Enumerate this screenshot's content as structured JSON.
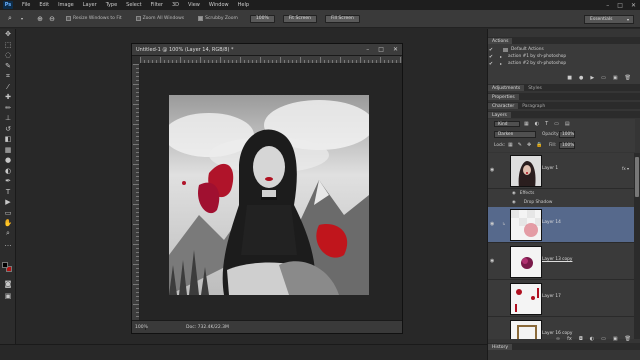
{
  "app": {
    "logo_text": "Ps"
  },
  "menu": [
    "File",
    "Edit",
    "Image",
    "Layer",
    "Type",
    "Select",
    "Filter",
    "3D",
    "View",
    "Window",
    "Help"
  ],
  "options_bar": {
    "resize_windows": "Resize Windows to Fit",
    "zoom_all": "Zoom All Windows",
    "scrubby_zoom": "Scrubby Zoom",
    "btn_100": "100%",
    "btn_fit": "Fit Screen",
    "btn_fill": "Fill Screen",
    "workspace": "Essentials"
  },
  "document": {
    "title": "Untitled-1 @ 100% (Layer 14, RGB/8) *",
    "zoom": "100%",
    "doc_info": "Doc: 732.4K/22.3M"
  },
  "actions_panel": {
    "tab": "Actions",
    "items": [
      {
        "label": "Default Actions",
        "indent": 0
      },
      {
        "label": "action #1 by sh-photoshop",
        "indent": 1
      },
      {
        "label": "action #2 by sh-photoshop",
        "indent": 1
      }
    ]
  },
  "panel_tabs_1": [
    "Adjustments",
    "Styles"
  ],
  "panel_tabs_2": [
    "Properties"
  ],
  "panel_tabs_3": [
    "Character",
    "Paragraph"
  ],
  "layers_panel": {
    "tab": "Layers",
    "filter_kind": "Kind",
    "blend_mode": "Darken",
    "opacity_label": "Opacity:",
    "opacity_value": "100%",
    "lock_label": "Lock:",
    "fill_label": "Fill:",
    "fill_value": "100%",
    "layers": [
      {
        "name": "Layer 1",
        "selected": false,
        "fx": true
      },
      {
        "name": "Layer 14",
        "selected": true,
        "fx": false
      },
      {
        "name": "Layer 13 copy",
        "selected": false,
        "fx": false
      },
      {
        "name": "Layer 17",
        "selected": false,
        "fx": false
      },
      {
        "name": "Layer 16 copy",
        "selected": false,
        "fx": false
      }
    ],
    "effects_label": "Effects",
    "drop_shadow_label": "Drop Shadow"
  },
  "history_tab": "History",
  "colors": {
    "selected_layer": "#56698c",
    "foreground": "#000000",
    "background_swatch": "#b01010",
    "brand": "#0d2d4a"
  },
  "icons": [
    "zoom-in-icon",
    "zoom-out-icon",
    "move-tool-icon",
    "marquee-icon",
    "lasso-icon",
    "quick-select-icon",
    "crop-icon",
    "eyedropper-icon",
    "healing-icon",
    "brush-icon",
    "stamp-icon",
    "history-brush-icon",
    "eraser-icon",
    "gradient-icon",
    "blur-icon",
    "dodge-icon",
    "pen-icon",
    "type-icon",
    "path-select-icon",
    "shape-icon",
    "hand-icon",
    "zoom-tool-icon",
    "eye-icon",
    "folder-icon",
    "fx-icon",
    "trash-icon",
    "new-layer-icon",
    "link-icon",
    "mask-icon"
  ]
}
